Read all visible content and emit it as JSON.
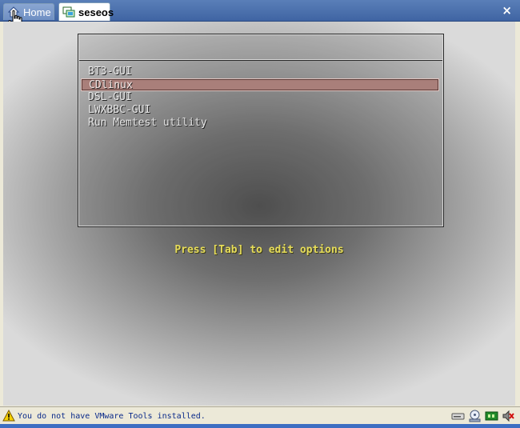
{
  "tabs": [
    {
      "label": "Home",
      "icon": "home-icon"
    },
    {
      "label": "seseos",
      "icon": "vm-icon"
    }
  ],
  "close_label": "×",
  "boot_menu": {
    "items": [
      "BT3-GUI",
      "CDlinux",
      "DSL-GUI",
      "LWXBBC-GUI",
      "Run Memtest utility"
    ],
    "selected_index": 1,
    "hint": "Press [Tab] to edit options"
  },
  "status": {
    "message": "You do not have VMware Tools installed.",
    "icons": [
      "warning-icon",
      "hard-disk-icon",
      "cdrom-icon",
      "network-icon",
      "audio-icon"
    ]
  },
  "colors": {
    "tabbar": "#3f64a3",
    "selection": "#a97f7a",
    "hint_text": "#e6dc5a",
    "status_text": "#0a2a8a"
  }
}
